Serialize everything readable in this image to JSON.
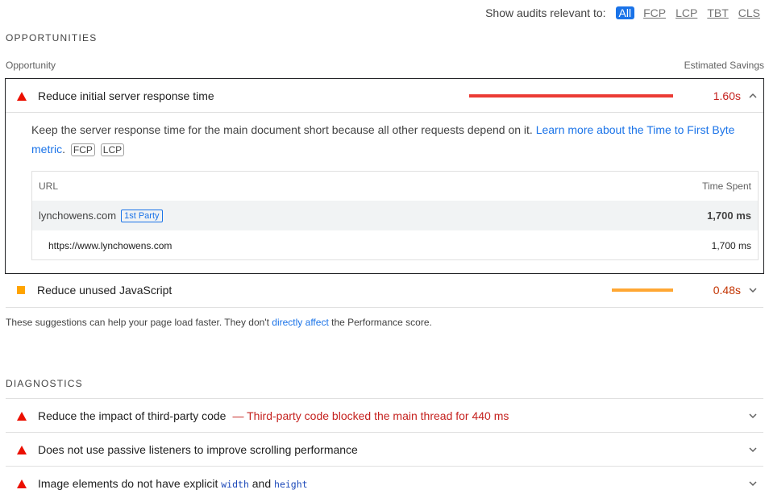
{
  "filter": {
    "label": "Show audits relevant to:",
    "options": [
      "All",
      "FCP",
      "LCP",
      "TBT",
      "CLS"
    ],
    "selected": "All"
  },
  "opportunities": {
    "section_title": "OPPORTUNITIES",
    "col_opportunity": "Opportunity",
    "col_savings": "Estimated Savings",
    "items": [
      {
        "title": "Reduce initial server response time",
        "savings": "1.60s",
        "bar_fraction": 1.0,
        "bar_color": "#eb3b34",
        "severity": "fail",
        "expanded": true,
        "description": "Keep the server response time for the main document short because all other requests depend on it.",
        "learn_more": "Learn more about the Time to First Byte metric",
        "metric_badges": [
          "FCP",
          "LCP"
        ],
        "table": {
          "col_url": "URL",
          "col_time": "Time Spent",
          "group": {
            "name": "lynchowens.com",
            "badge": "1st Party",
            "time": "1,700 ms"
          },
          "rows": [
            {
              "url": "https://www.lynchowens.com",
              "time": "1,700 ms"
            }
          ]
        }
      },
      {
        "title": "Reduce unused JavaScript",
        "savings": "0.48s",
        "bar_fraction": 0.3,
        "bar_color": "#ffa733",
        "severity": "average",
        "expanded": false
      }
    ],
    "note_before": "These suggestions can help your page load faster. They don't ",
    "note_link": "directly affect",
    "note_after": " the Performance score."
  },
  "diagnostics": {
    "section_title": "DIAGNOSTICS",
    "items": [
      {
        "title": "Reduce the impact of third-party code",
        "warning": "— Third-party code blocked the main thread for 440 ms"
      },
      {
        "title": "Does not use passive listeners to improve scrolling performance"
      },
      {
        "title_before": "Image elements do not have explicit ",
        "code1": "width",
        "title_mid": " and ",
        "code2": "height"
      }
    ]
  },
  "colors": {
    "fail": "#eb0f00",
    "average": "#ffa400",
    "link": "#1a73e8"
  }
}
